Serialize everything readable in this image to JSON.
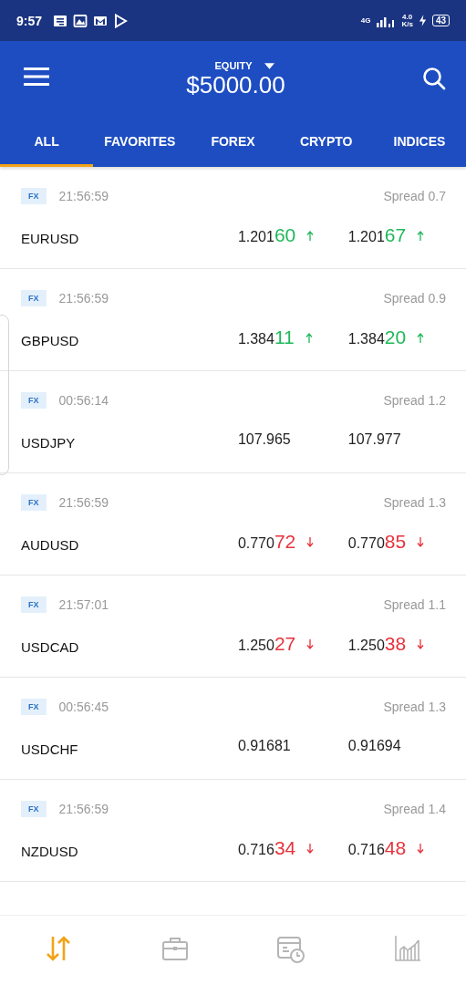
{
  "status_bar": {
    "time": "9:57",
    "network": "4G",
    "speed_value": "4.0",
    "speed_unit": "K/s",
    "battery": "43"
  },
  "header": {
    "label": "EQUITY",
    "amount": "$5000.00"
  },
  "tabs": [
    {
      "label": "ALL",
      "selected": true
    },
    {
      "label": "FAVORITES",
      "selected": false
    },
    {
      "label": "FOREX",
      "selected": false
    },
    {
      "label": "CRYPTO",
      "selected": false
    },
    {
      "label": "INDICES",
      "selected": false
    }
  ],
  "instruments": [
    {
      "badge": "FX",
      "time": "21:56:59",
      "spread": "Spread 0.7",
      "symbol": "EURUSD",
      "bid": {
        "base": "1.201",
        "pips": "60",
        "rising": true
      },
      "ask": {
        "base": "1.201",
        "pips": "67",
        "rising": true
      }
    },
    {
      "badge": "FX",
      "time": "21:56:59",
      "spread": "Spread 0.9",
      "symbol": "GBPUSD",
      "bid": {
        "base": "1.384",
        "pips": "11",
        "rising": true
      },
      "ask": {
        "base": "1.384",
        "pips": "20",
        "rising": true
      }
    },
    {
      "badge": "FX",
      "time": "00:56:14",
      "spread": "Spread 1.2",
      "symbol": "USDJPY",
      "bid": {
        "base": "107.965"
      },
      "ask": {
        "base": "107.977"
      }
    },
    {
      "badge": "FX",
      "time": "21:56:59",
      "spread": "Spread 1.3",
      "symbol": "AUDUSD",
      "bid": {
        "base": "0.770",
        "pips": "72",
        "rising": false
      },
      "ask": {
        "base": "0.770",
        "pips": "85",
        "rising": false
      }
    },
    {
      "badge": "FX",
      "time": "21:57:01",
      "spread": "Spread 1.1",
      "symbol": "USDCAD",
      "bid": {
        "base": "1.250",
        "pips": "27",
        "rising": false
      },
      "ask": {
        "base": "1.250",
        "pips": "38",
        "rising": false
      }
    },
    {
      "badge": "FX",
      "time": "00:56:45",
      "spread": "Spread 1.3",
      "symbol": "USDCHF",
      "bid": {
        "base": "0.91681"
      },
      "ask": {
        "base": "0.91694"
      }
    },
    {
      "badge": "FX",
      "time": "21:56:59",
      "spread": "Spread 1.4",
      "symbol": "NZDUSD",
      "bid": {
        "base": "0.716",
        "pips": "34",
        "rising": false
      },
      "ask": {
        "base": "0.716",
        "pips": "48",
        "rising": false
      }
    }
  ],
  "bottom_nav": [
    {
      "kind": "trade",
      "selected": true
    },
    {
      "kind": "portfolio",
      "selected": false
    },
    {
      "kind": "history",
      "selected": false
    },
    {
      "kind": "chart",
      "selected": false
    }
  ]
}
